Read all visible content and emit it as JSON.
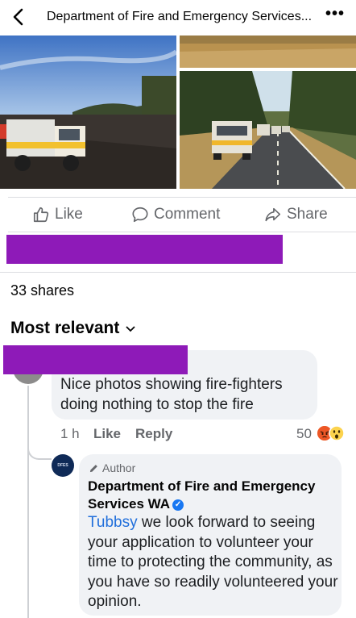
{
  "header": {
    "title": "Department of Fire and Emergency Services...",
    "back_icon": "chevron-left-icon",
    "more_icon": "more-horizontal-icon",
    "more_glyph": "•••"
  },
  "actions": {
    "like": "Like",
    "comment": "Comment",
    "share": "Share"
  },
  "post": {
    "shares": "33 shares"
  },
  "comments": {
    "sort_label": "Most relevant",
    "items": [
      {
        "text": "Nice photos showing  fire-fighters doing nothing to stop the fire",
        "time": "1 h",
        "like": "Like",
        "reply": "Reply",
        "reaction_count": "50",
        "reactions": [
          "angry",
          "wow"
        ]
      }
    ],
    "reply": {
      "author_badge": "Author",
      "page_name": "Department of Fire and Emergency Services WA",
      "mention": "Tubbsy",
      "text": " we look forward to seeing your application to volunteer your time to protecting the community, as you have so readily volunteered your opinion."
    }
  },
  "colors": {
    "redaction": "#8e1ab8",
    "link": "#216fdb",
    "verified": "#1877f2",
    "bubble": "#f0f2f5",
    "muted_text": "#65676b"
  }
}
